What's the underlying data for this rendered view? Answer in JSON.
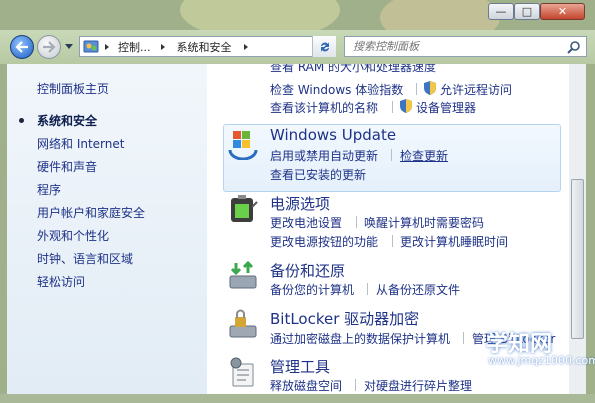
{
  "window": {
    "buttons": {
      "minimize": "—",
      "maximize": "□",
      "close": "✕"
    }
  },
  "nav": {
    "breadcrumb": [
      "控制...",
      "系统和安全"
    ],
    "search_placeholder": "搜索控制面板"
  },
  "sidebar": {
    "home": "控制面板主页",
    "items": [
      {
        "label": "系统和安全",
        "active": true
      },
      {
        "label": "网络和 Internet",
        "active": false
      },
      {
        "label": "硬件和声音",
        "active": false
      },
      {
        "label": "程序",
        "active": false
      },
      {
        "label": "用户帐户和家庭安全",
        "active": false
      },
      {
        "label": "外观和个性化",
        "active": false
      },
      {
        "label": "时钟、语言和区域",
        "active": false
      },
      {
        "label": "轻松访问",
        "active": false
      }
    ]
  },
  "main": {
    "system": {
      "partial_top": "查看 RAM 的大小和处理器速度",
      "links": [
        "检查 Windows 体验指数",
        "允许远程访问",
        "查看该计算机的名称",
        "设备管理器"
      ]
    },
    "windows_update": {
      "title": "Windows Update",
      "links": [
        "启用或禁用自动更新",
        "检查更新",
        "查看已安装的更新"
      ]
    },
    "power": {
      "title": "电源选项",
      "links": [
        "更改电池设置",
        "唤醒计算机时需要密码",
        "更改电源按钮的功能",
        "更改计算机睡眠时间"
      ]
    },
    "backup": {
      "title": "备份和还原",
      "links": [
        "备份您的计算机",
        "从备份还原文件"
      ]
    },
    "bitlocker": {
      "title": "BitLocker 驱动器加密",
      "links": [
        "通过加密磁盘上的数据保护计算机",
        "管理 BitLocker"
      ]
    },
    "admin": {
      "title": "管理工具",
      "links": [
        "释放磁盘空间",
        "对硬盘进行碎片整理"
      ]
    }
  },
  "watermark": {
    "name": "学知网",
    "url": "www.jmqz1000.com"
  },
  "colors": {
    "link": "#1e3287",
    "accent": "#3c74c4"
  }
}
